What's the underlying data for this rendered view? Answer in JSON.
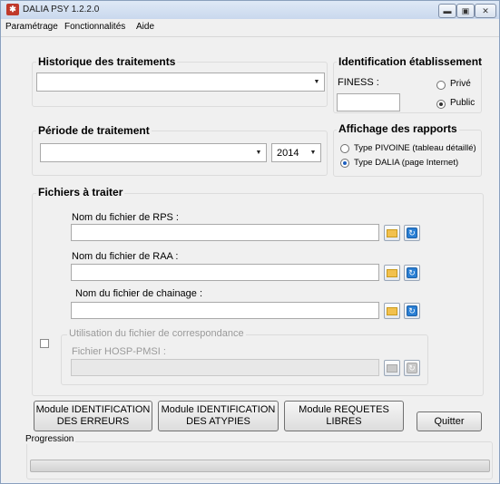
{
  "window": {
    "title": "DALIA PSY 1.2.2.0",
    "icon": "app-icon"
  },
  "menu": {
    "items": [
      "Paramétrage",
      "Fonctionnalités",
      "Aide"
    ]
  },
  "historique": {
    "label": "Historique des traitements",
    "value": ""
  },
  "identification": {
    "label": "Identification établissement",
    "finess_label": "FINESS :",
    "finess_value": "",
    "options": [
      {
        "label": "Privé",
        "checked": false
      },
      {
        "label": "Public",
        "checked": true
      }
    ]
  },
  "periode": {
    "label": "Période de traitement",
    "periode_value": "",
    "year": "2014"
  },
  "rapports": {
    "label": "Affichage des rapports",
    "options": [
      {
        "label": "Type PIVOINE (tableau détaillé)",
        "checked": false
      },
      {
        "label": "Type DALIA (page Internet)",
        "checked": true
      }
    ]
  },
  "fichiers": {
    "label": "Fichiers à traiter",
    "rps_label": "Nom du fichier de RPS :",
    "raa_label": "Nom du fichier de RAA :",
    "chainage_label": "Nom du fichier de chainage :",
    "correspondance_label": "Utilisation du fichier de correspondance",
    "correspondance_checked": false,
    "hosp_label": "Fichier HOSP-PMSI :"
  },
  "buttons": {
    "module_erreurs": [
      "Module IDENTIFICATION",
      "DES ERREURS"
    ],
    "module_atypies": [
      "Module IDENTIFICATION",
      "DES ATYPIES"
    ],
    "module_requetes": [
      "Module REQUETES",
      "LIBRES"
    ],
    "quitter": "Quitter"
  },
  "progression": {
    "label": "Progression",
    "value": 0
  }
}
